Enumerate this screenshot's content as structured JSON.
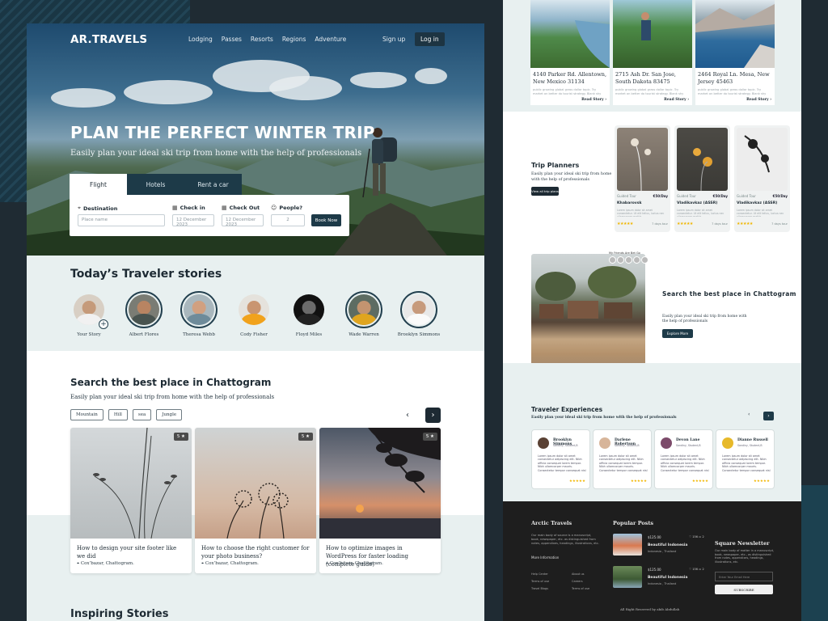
{
  "nav": {
    "logo": "AR.TRAVELS",
    "links": [
      "Lodging",
      "Passes",
      "Resorts",
      "Regions",
      "Adventure"
    ],
    "signup": "Sign up",
    "login": "Log in"
  },
  "hero": {
    "title": "PLAN THE PERFECT WINTER TRIP",
    "subtitle": "Easily plan your ideal ski trip from home with the help of professionals",
    "tabs": [
      "Flight",
      "Hotels",
      "Rent a car"
    ],
    "active_tab": "Flight",
    "form": {
      "destination_label": "Destination",
      "destination_placeholder": "Place name",
      "checkin_label": "Check in",
      "checkin_value": "12 December 2023",
      "checkout_label": "Check Out",
      "checkout_value": "12 December 2023",
      "people_label": "People?",
      "people_value": "2",
      "book_button": "Book Now"
    }
  },
  "stories": {
    "title": "Today’s Traveler stories",
    "people": [
      {
        "name": "Your Story"
      },
      {
        "name": "Albert Flores"
      },
      {
        "name": "Theresa Webb"
      },
      {
        "name": "Cody Fisher"
      },
      {
        "name": "Floyd Miles"
      },
      {
        "name": "Wade Warren"
      },
      {
        "name": "Brooklyn Simmons"
      }
    ]
  },
  "search": {
    "title": "Search the best place in Chattogram",
    "subtitle": "Easily plan your ideal ski trip from home with the help of professionals",
    "chips": [
      "Mountain",
      "Hill",
      "sea",
      "Jungle"
    ],
    "cards": [
      {
        "rating": "5 ★",
        "title": "How to design your site footer like we did",
        "location": "Cox’bazar, Chattogram."
      },
      {
        "rating": "5 ★",
        "title": "How to choose the right customer for your photo business?",
        "location": "Cox’bazar, Chattogram."
      },
      {
        "rating": "5 ★",
        "title": "How to optimize images in WordPress for faster loading (complete guide)",
        "location": "Cox’bazar, Chattogram."
      }
    ]
  },
  "inspiring": {
    "title": "Inspiring Stories"
  },
  "places": [
    {
      "address": "4140 Parker Rd. Allentown, New Mexico 31134",
      "blurb": "public growing global grass dollar topic. Try market on better do tourist strategy. Blank shy long day. Market.",
      "link": "Read Story ›"
    },
    {
      "address": "2715 Ash Dr. San Jose, South Dakota 83475",
      "blurb": "public growing global grass dollar topic. Try market on better do tourist strategy. Blank shy long day. Market.",
      "link": "Read Story ›"
    },
    {
      "address": "2464 Royal Ln. Mesa, New Jersey 45463",
      "blurb": "public growing global grass dollar topic. Try market on better do tourist strategy. Blank shy long day. Market.",
      "link": "Read Story ›"
    }
  ],
  "trip_planners": {
    "title": "Trip Planners",
    "subtitle": "Easily plan your ideal ski trip from home with the help of professionals",
    "button": "View all trip plans",
    "cards": [
      {
        "meta_left": "Guided Tour",
        "price": "€50/Day",
        "name": "Khabarovsk",
        "desc": "Lorem ipsum dolor sit amet consectetur. Ut elit tellus, luctus nec ullamcorper mattis.",
        "stars": "★★★★★",
        "days": "7 days tour"
      },
      {
        "meta_left": "Guided Tour",
        "price": "€50/Day",
        "name": "Vladikavkaz (ASSR)",
        "desc": "Lorem ipsum dolor sit amet consectetur. Ut elit tellus, luctus nec ullamcorper mattis.",
        "stars": "★★★★★",
        "days": "7 days tour"
      },
      {
        "meta_left": "Guided Tour",
        "price": "€50/Day",
        "name": "Vladikavkaz (ASSR)",
        "desc": "Lorem ipsum dolor sit amet consectetur. Ut elit tellus, luctus nec ullamcorper mattis.",
        "stars": "★★★★★",
        "days": "7 days tour"
      }
    ]
  },
  "chattogram": {
    "caption": "My Friends Are Bet Go",
    "title": "Search the best place in Chattogram",
    "subtitle": "Easily plan your ideal ski trip from home with the help of professionals",
    "button": "Explore More"
  },
  "experiences": {
    "title": "Traveler Experiences",
    "subtitle": "Easily plan your ideal ski trip from home with the help of professionals",
    "items": [
      {
        "name": "Brooklyn Simmons",
        "role": "Sandiny, Student,B",
        "text": "Lorem ipsum dolor sit amet consectetur adipiscing elit. Nibh officia consequat lorem tempor. Nibh ullamcorper mauris. Consectetur tempor consequat nisl eiusmod amet.",
        "stars": "★★★★★"
      },
      {
        "name": "Darlene Robertson",
        "role": "Sandiny, Student,B",
        "text": "Lorem ipsum dolor sit amet consectetur adipiscing elit. Nibh officia consequat lorem tempor. Nibh ullamcorper mauris. Consectetur tempor consequat nisl eiusmod amet.",
        "stars": "★★★★★"
      },
      {
        "name": "Devon Lane",
        "role": "Sandiny, Student,B",
        "text": "Lorem ipsum dolor sit amet consectetur adipiscing elit. Nibh officia consequat lorem tempor. Nibh ullamcorper mauris. Consectetur tempor consequat nisl eiusmod amet.",
        "stars": "★★★★★"
      },
      {
        "name": "Dianne Russell",
        "role": "Sandiny, Student,B",
        "text": "Lorem ipsum dolor sit amet consectetur adipiscing elit. Nibh officia consequat lorem tempor. Nibh ullamcorper mauris. Consectetur tempor consequat nisl eiusmod amet.",
        "stars": "★★★★★"
      }
    ]
  },
  "footer": {
    "brand": "Arctic Travels",
    "brand_text": "Our main body of source is a manuscript, book, newspaper, etc. as distinguished from notes, appendixes, headings, illustrations, etc.",
    "more_info": "More Information",
    "links": [
      "Help Center",
      "About us",
      "Terms of use",
      "Careers",
      "Travel Blogs",
      "Terms of use"
    ],
    "popular_title": "Popular Posts",
    "posts": [
      {
        "price": "$125.00",
        "name": "Beautiful Indonesia",
        "location": "Indonesia , Thailand",
        "stats": "♡ 156   ▭ 2"
      },
      {
        "price": "$125.00",
        "name": "Beautiful Indonesia",
        "location": "Indonesia , Thailand",
        "stats": "♡ 156   ▭ 2"
      }
    ],
    "newsletter_title": "Square Newsletter",
    "newsletter_text": "Our main body of matter in a manuscript, book, newspaper, etc., as distinguished from notes, appendixes, headings, illustrations, etc.",
    "email_placeholder": "Enter Your Email Here",
    "subscribe": "SUBSCRIBE",
    "copyright": "All Right Reserved by akib Abdullah"
  },
  "colors": {
    "primary": "#1d3a48",
    "accent_star": "#f1b600",
    "tint": "#e8f0f0",
    "footer": "#1e1e1e"
  }
}
